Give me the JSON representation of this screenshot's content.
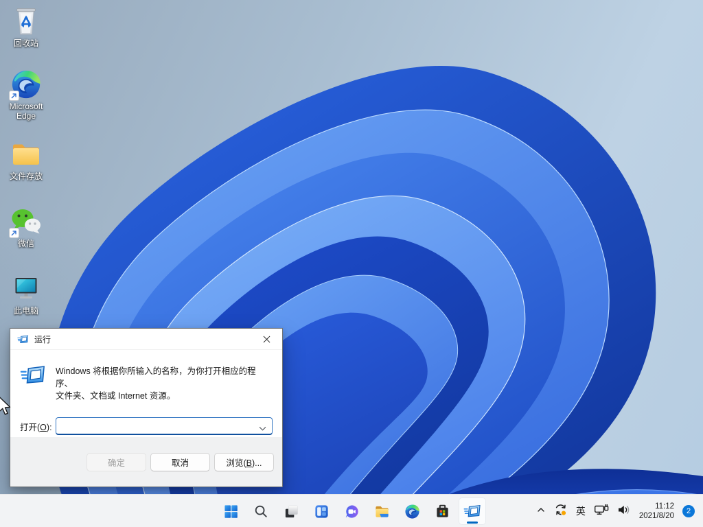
{
  "desktop_icons": [
    {
      "name": "recycle-bin",
      "icon": "recycle-bin-icon",
      "label": "回收站"
    },
    {
      "name": "microsoft-edge",
      "icon": "edge-icon",
      "label": "Microsoft Edge",
      "shortcut": true
    },
    {
      "name": "file-storage",
      "icon": "folder-icon",
      "label": "文件存放"
    },
    {
      "name": "wechat",
      "icon": "wechat-icon",
      "label": "微信",
      "shortcut": true
    },
    {
      "name": "this-pc",
      "icon": "monitor-icon",
      "label": "此电脑"
    }
  ],
  "run_dialog": {
    "title": "运行",
    "icon": "run-icon",
    "close_icon": "close-icon",
    "description_line1": "Windows 将根据你所输入的名称，为你打开相应的程序、",
    "description_line2": "文件夹、文档或 Internet 资源。",
    "open_label": {
      "pre": "打开(",
      "key": "O",
      "post": "):"
    },
    "input_value": "",
    "buttons": {
      "ok": "确定",
      "cancel": "取消",
      "browse": {
        "pre": "浏览(",
        "key": "B",
        "post": ")..."
      }
    }
  },
  "taskbar": {
    "items": [
      {
        "name": "start",
        "icon": "start-icon"
      },
      {
        "name": "search",
        "icon": "search-icon"
      },
      {
        "name": "task-view",
        "icon": "task-view-icon"
      },
      {
        "name": "widgets",
        "icon": "widgets-icon"
      },
      {
        "name": "chat",
        "icon": "chat-icon"
      },
      {
        "name": "file-explorer",
        "icon": "file-explorer-icon"
      },
      {
        "name": "edge",
        "icon": "edge-icon"
      },
      {
        "name": "store",
        "icon": "store-icon"
      },
      {
        "name": "run",
        "icon": "run-icon",
        "active": true
      }
    ],
    "tray": {
      "chevron_icon": "chevron-up-icon",
      "update_icon": "update-status-icon",
      "ime": "英",
      "network_icon": "ethernet-icon",
      "volume_icon": "speaker-icon",
      "time": "11:12",
      "date": "2021/8/20",
      "notification_count": "2"
    }
  },
  "colors": {
    "accent": "#0067c0",
    "taskbar_bg": "#f2f3f5",
    "dialog_footer_bg": "#f0f1f2",
    "badge_bg": "#0b77d9",
    "bloom_dark": "#12379e",
    "bloom_mid": "#2c67e6",
    "bloom_light": "#6ea6f6",
    "update_dot": "#f7a400"
  }
}
